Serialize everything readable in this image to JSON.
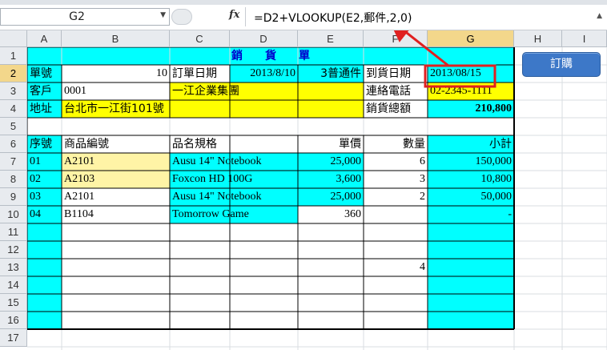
{
  "name_box": "G2",
  "formula": "=D2+VLOOKUP(E2,郵件,2,0)",
  "button": "訂購",
  "columns": [
    "A",
    "B",
    "C",
    "D",
    "E",
    "F",
    "G",
    "H",
    "I"
  ],
  "rows": [
    "1",
    "2",
    "3",
    "4",
    "5",
    "6",
    "7",
    "8",
    "9",
    "10",
    "11",
    "12",
    "13",
    "14",
    "15",
    "16",
    "17"
  ],
  "sheet": {
    "title": "銷　　貨　　單",
    "order_no_label": "單號",
    "order_no": "10",
    "order_date_label": "訂單日期",
    "order_date": "2013/8/10",
    "shipping": "3普通件",
    "arrival_label": "到貨日期",
    "arrival_date": "2013/08/15",
    "customer_label": "客戶",
    "customer_id": "0001",
    "customer_name": "一江企業集團",
    "phone_label": "連絡電話",
    "phone": "02-2345-1111",
    "address_label": "地址",
    "address": "台北市一江街101號",
    "total_label": "銷貨總額",
    "total": "210,800",
    "headers": {
      "seq": "序號",
      "code": "商品編號",
      "spec": "品名規格",
      "price": "單價",
      "qty": "數量",
      "subtotal": "小計"
    },
    "items": [
      {
        "seq": "01",
        "code": "A2101",
        "spec": "Ausu 14\" Notebook",
        "price": "25,000",
        "qty": "6",
        "subtotal": "150,000"
      },
      {
        "seq": "02",
        "code": "A2103",
        "spec": "Foxcon HD 100G",
        "price": "3,600",
        "qty": "3",
        "subtotal": "10,800"
      },
      {
        "seq": "03",
        "code": "A2101",
        "spec": "Ausu 14\" Notebook",
        "price": "25,000",
        "qty": "2",
        "subtotal": "50,000"
      },
      {
        "seq": "04",
        "code": "B1104",
        "spec": "Tomorrow Game",
        "price": "360",
        "qty": "",
        "subtotal": "-"
      }
    ],
    "row13_qty": "4"
  }
}
